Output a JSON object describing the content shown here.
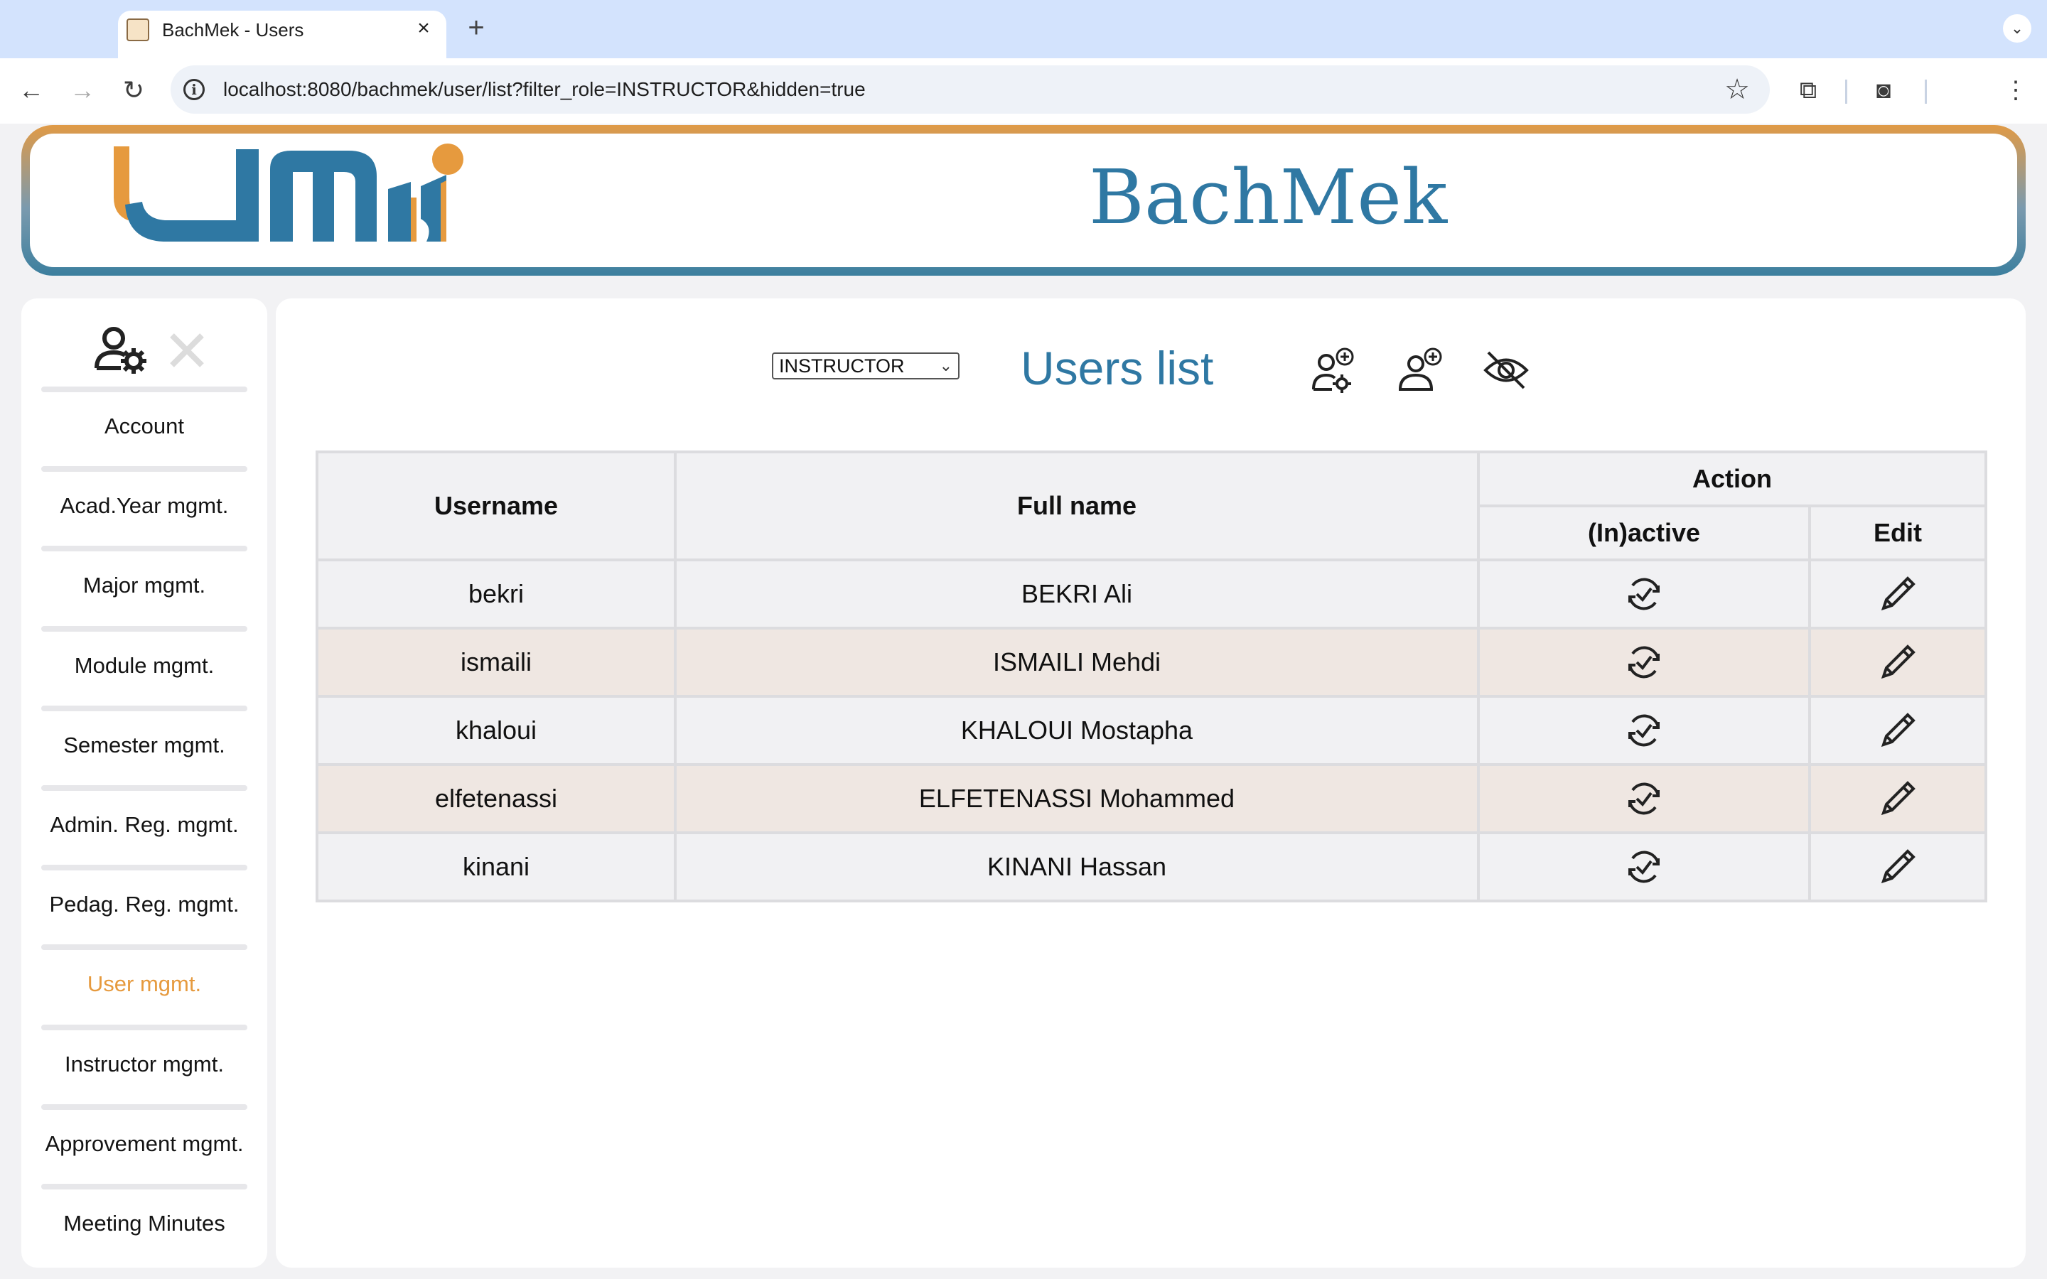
{
  "browser": {
    "tab_title": "BachMek - Users",
    "url": "localhost:8080/bachmek/user/list?filter_role=INSTRUCTOR&hidden=true",
    "icons": [
      "back-icon",
      "forward-icon",
      "reload-icon",
      "info-icon",
      "star-icon",
      "extensions-icon",
      "screenshot-icon",
      "menu-icon"
    ]
  },
  "header": {
    "brand": "BachMek",
    "logo": "umi-logo"
  },
  "sidebar": {
    "top_icons": [
      "user-settings-icon",
      "close-icon"
    ],
    "items": [
      {
        "label": "Account",
        "active": false
      },
      {
        "label": "Acad.Year mgmt.",
        "active": false
      },
      {
        "label": "Major mgmt.",
        "active": false
      },
      {
        "label": "Module mgmt.",
        "active": false
      },
      {
        "label": "Semester mgmt.",
        "active": false
      },
      {
        "label": "Admin. Reg. mgmt.",
        "active": false
      },
      {
        "label": "Pedag. Reg. mgmt.",
        "active": false
      },
      {
        "label": "User mgmt.",
        "active": true
      },
      {
        "label": "Instructor mgmt.",
        "active": false
      },
      {
        "label": "Approvement mgmt.",
        "active": false
      },
      {
        "label": "Meeting Minutes",
        "active": false
      }
    ]
  },
  "main": {
    "role_filter": {
      "selected": "INSTRUCTOR"
    },
    "title": "Users list",
    "actions": [
      "add-admin-user-icon",
      "add-user-icon",
      "hide-icon"
    ],
    "table": {
      "headers": {
        "username": "Username",
        "full_name": "Full name",
        "action": "Action",
        "inactive": "(In)active",
        "edit": "Edit"
      },
      "rows": [
        {
          "username": "bekri",
          "full_name": "BEKRI Ali"
        },
        {
          "username": "ismaili",
          "full_name": "ISMAILI Mehdi"
        },
        {
          "username": "khaloui",
          "full_name": "KHALOUI Mostapha"
        },
        {
          "username": "elfetenassi",
          "full_name": "ELFETENASSI Mohammed"
        },
        {
          "username": "kinani",
          "full_name": "KINANI Hassan"
        }
      ]
    }
  },
  "colors": {
    "brand_blue": "#2f78a3",
    "accent_orange": "#e69a3e",
    "row_alt": "#efe7e2",
    "row_base": "#f1f1f3"
  }
}
